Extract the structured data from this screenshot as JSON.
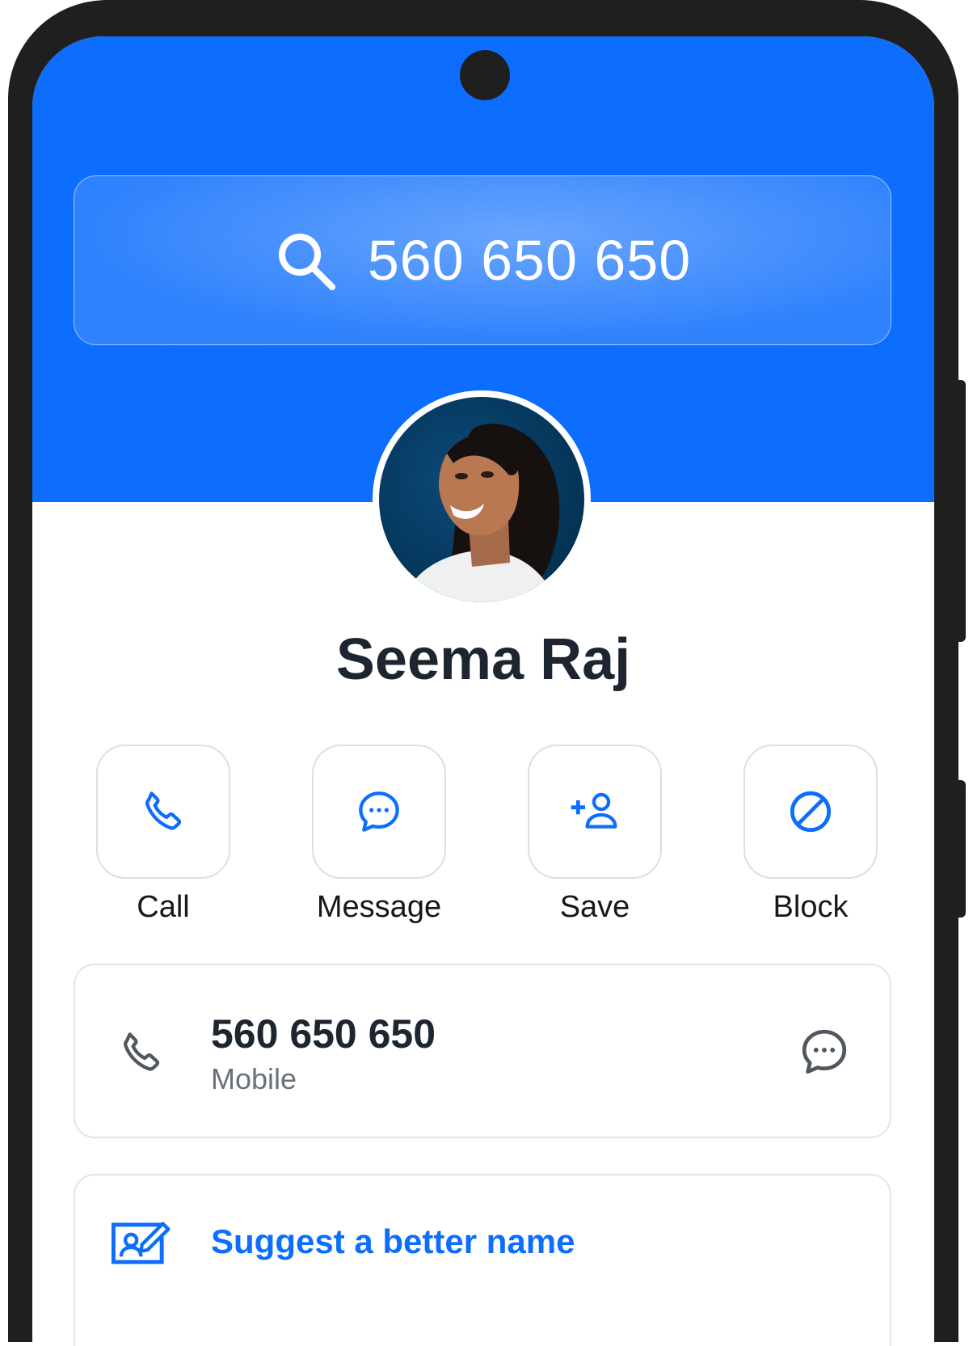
{
  "search": {
    "query": "560 650 650"
  },
  "contact": {
    "name": "Seema Raj",
    "avatar": "portrait-photo"
  },
  "actions": [
    {
      "label": "Call",
      "icon": "phone-icon"
    },
    {
      "label": "Message",
      "icon": "chat-bubble-icon"
    },
    {
      "label": "Save",
      "icon": "add-person-icon"
    },
    {
      "label": "Block",
      "icon": "block-icon"
    }
  ],
  "phone_entry": {
    "number": "560 650 650",
    "type": "Mobile",
    "icon": "phone-icon",
    "action_icon": "chat-bubble-icon"
  },
  "suggest": {
    "label": "Suggest a better name",
    "icon": "edit-name-icon"
  },
  "colors": {
    "accent": "#0d6efd",
    "frame": "#1f1f1f",
    "text_dark": "#1d2530",
    "text_muted": "#6b7178"
  }
}
